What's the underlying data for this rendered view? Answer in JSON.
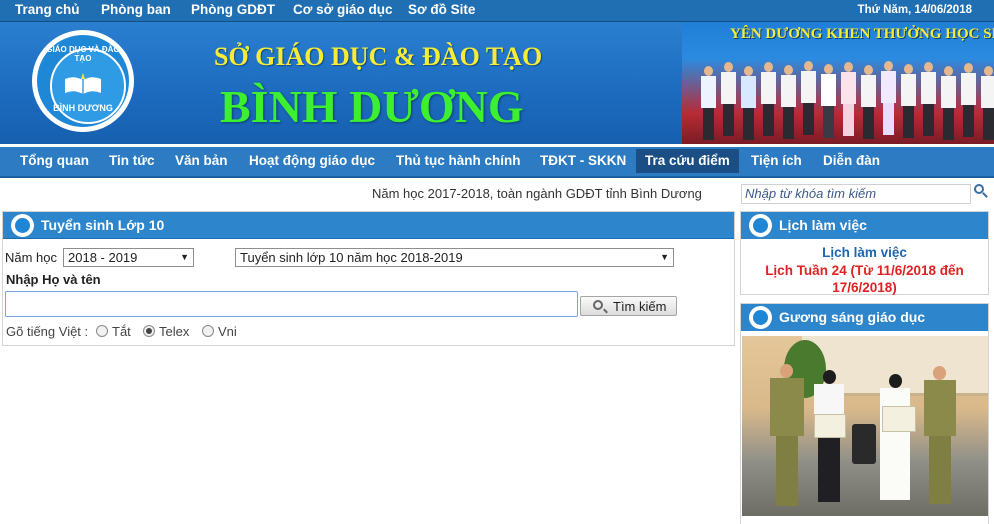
{
  "top_bar": {
    "links": [
      "Trang chủ",
      "Phòng ban",
      "Phòng GDĐT",
      "Cơ sở giáo dục",
      "Sơ đồ Site"
    ],
    "date": "Thứ Năm, 14/06/2018"
  },
  "banner": {
    "logo_arc_text": "GIÁO DỤC VÀ ĐÀO TẠO",
    "logo_name": "BÌNH DƯƠNG",
    "title_line1": "SỞ GIÁO DỤC & ĐÀO TẠO",
    "title_line2": "BÌNH DƯƠNG",
    "photo_caption": "YÊN DƯƠNG KHEN THƯỞNG HỌC SINH GIỎI"
  },
  "nav": {
    "items": [
      "Tổng quan",
      "Tin tức",
      "Văn bản",
      "Hoạt động giáo dục",
      "Thủ tục hành chính",
      "TĐKT - SKKN",
      "Tra cứu điểm",
      "Tiện ích",
      "Diễn đàn"
    ],
    "active_index": 6
  },
  "year_line": "Năm học 2017-2018, toàn ngành GDĐT tỉnh Bình Dương",
  "search_panel": {
    "title": "Tuyển sinh Lớp 10",
    "year_label": "Năm học",
    "year_value": "2018 - 2019",
    "exam_value": "Tuyển sinh lớp 10 năm học 2018-2019",
    "name_label": "Nhập Họ và tên",
    "name_value": "",
    "search_button": "Tìm kiếm",
    "typing_label": "Gõ tiếng Việt :",
    "typing_options": [
      "Tắt",
      "Telex",
      "Vni"
    ],
    "typing_selected": "Telex"
  },
  "sidebar": {
    "search_placeholder": "Nhập từ khóa tìm kiếm",
    "schedule": {
      "title": "Lịch làm việc",
      "link": "Lịch làm việc",
      "week": "Lịch Tuần 24 (Từ 11/6/2018 đến 17/6/2018)"
    },
    "gallery": {
      "title": "Gương sáng giáo dục"
    }
  },
  "colors": {
    "bar_blue": "#1f6fb2",
    "nav_blue": "#2d7cc3",
    "title_yellow": "#f7ec35",
    "title_green": "#3df02f",
    "week_red": "#e02121"
  }
}
